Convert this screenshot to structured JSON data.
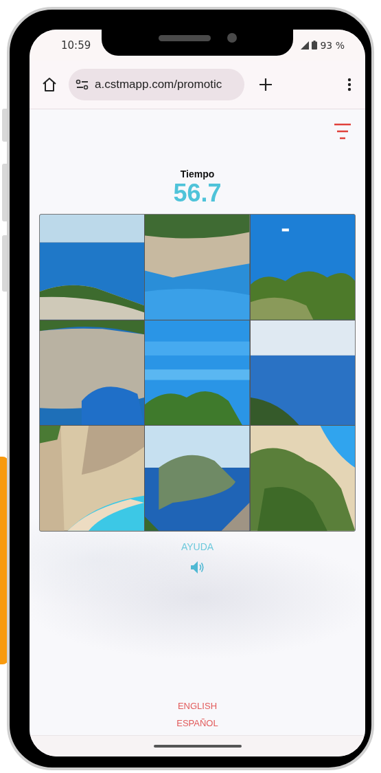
{
  "status_bar": {
    "time": "10:59",
    "battery": "93 %"
  },
  "browser": {
    "url": "a.cstmapp.com/promotic"
  },
  "game": {
    "timer_label": "Tiempo",
    "timer_value": "56.7",
    "help": "AYUDA"
  },
  "languages": [
    "ENGLISH",
    "ESPAÑOL"
  ]
}
